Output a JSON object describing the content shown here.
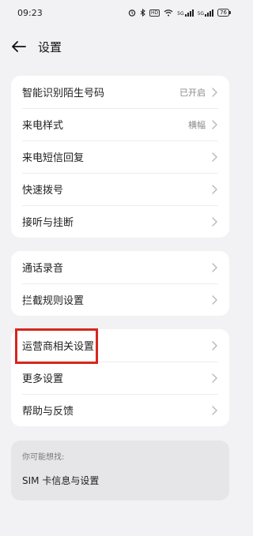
{
  "status_bar": {
    "time": "09:23",
    "network_badge": "HD",
    "signal_1_label": "5G",
    "signal_2_label": "5G",
    "battery_level": "76",
    "icons": [
      "alarm-icon",
      "bluetooth-icon",
      "hd-icon",
      "wifi-icon",
      "signal-icon",
      "signal-icon",
      "battery-icon"
    ]
  },
  "header": {
    "back_icon": "arrow-left-icon",
    "title": "设置"
  },
  "group1": [
    {
      "label": "智能识别陌生号码",
      "value": "已开启"
    },
    {
      "label": "来电样式",
      "value": "横幅"
    },
    {
      "label": "来电短信回复",
      "value": ""
    },
    {
      "label": "快速拨号",
      "value": ""
    },
    {
      "label": "接听与挂断",
      "value": ""
    }
  ],
  "group2": [
    {
      "label": "通话录音"
    },
    {
      "label": "拦截规则设置"
    }
  ],
  "group3": [
    {
      "label": "运营商相关设置"
    },
    {
      "label": "更多设置"
    },
    {
      "label": "帮助与反馈"
    }
  ],
  "suggestions": {
    "title": "你可能想找:",
    "items": [
      {
        "label": "SIM 卡信息与设置"
      }
    ]
  },
  "highlight_color": "#d7261c"
}
